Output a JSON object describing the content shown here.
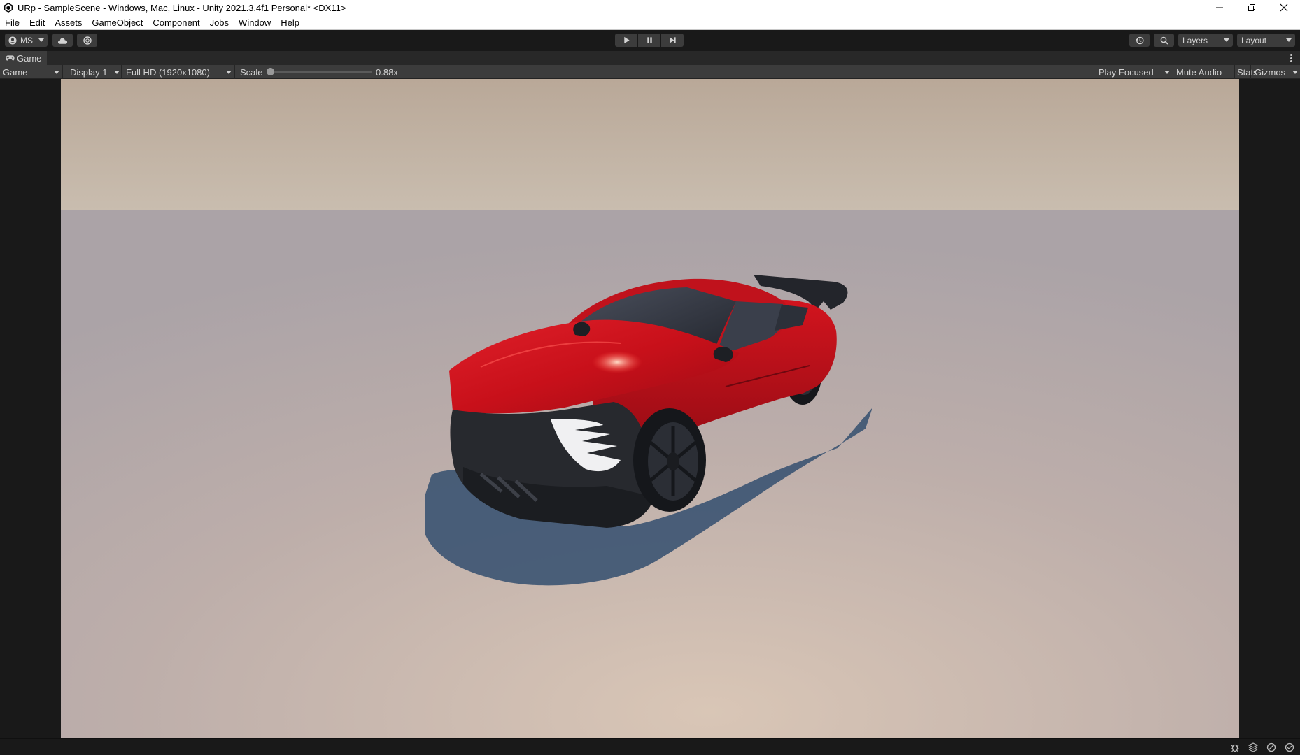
{
  "window": {
    "title": "URp - SampleScene - Windows, Mac, Linux - Unity 2021.3.4f1 Personal* <DX11>"
  },
  "menu": [
    "File",
    "Edit",
    "Assets",
    "GameObject",
    "Component",
    "Jobs",
    "Window",
    "Help"
  ],
  "toolbar": {
    "account_label": "MS",
    "layers_label": "Layers",
    "layout_label": "Layout"
  },
  "tab": {
    "label": "Game"
  },
  "gamebar": {
    "view_mode": "Game",
    "display": "Display 1",
    "resolution": "Full HD (1920x1080)",
    "scale_label": "Scale",
    "scale_value": "0.88x",
    "play_mode": "Play Focused",
    "mute_audio": "Mute Audio",
    "stats": "Stats",
    "gizmos": "Gizmos"
  },
  "colors": {
    "car_body": "#d4141e",
    "sky": "#c4b6a6",
    "ground": "#b8aeae",
    "shadow": "#3e5673",
    "editor_dark": "#191919",
    "editor_panel": "#3c3c3c"
  }
}
